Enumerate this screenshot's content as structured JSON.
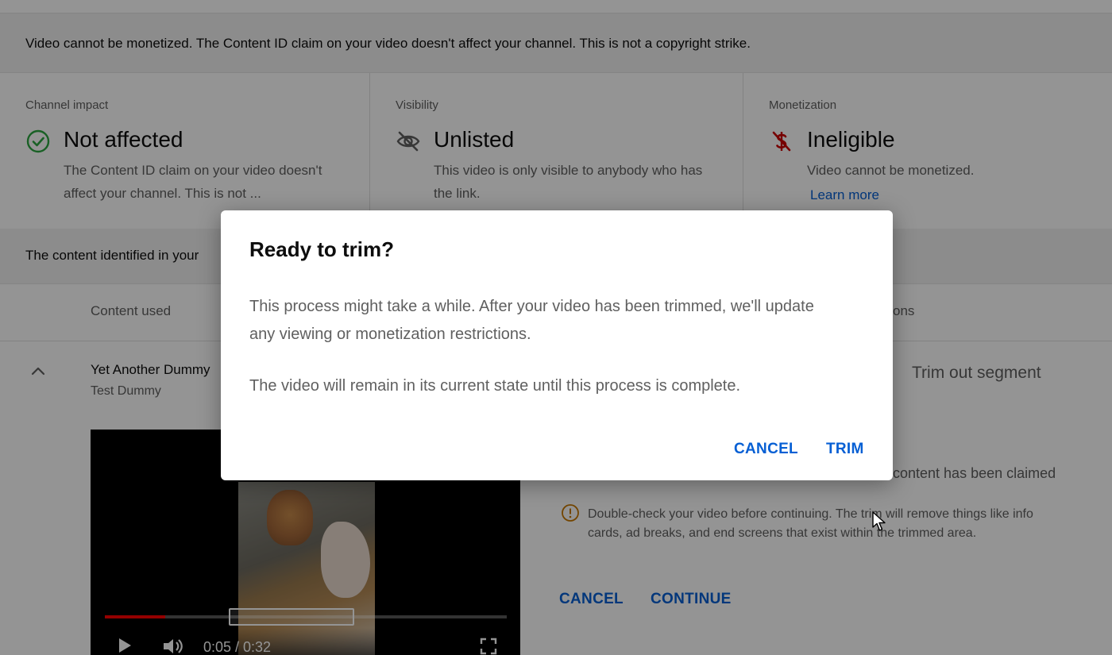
{
  "notice": {
    "text": "Video cannot be monetized. The Content ID claim on your video doesn't affect your channel. This is not a copyright strike."
  },
  "status": [
    {
      "caption": "Channel impact",
      "icon": "check-circle-icon",
      "value": "Not affected",
      "description": "The Content ID claim on your video doesn't affect your channel. This is not ...",
      "color": "#2ba640"
    },
    {
      "caption": "Visibility",
      "icon": "eye-off-icon",
      "value": "Unlisted",
      "description": "This video is only visible to anybody who has the link.",
      "color": "#606060"
    },
    {
      "caption": "Monetization",
      "icon": "dollar-off-icon",
      "value": "Ineligible",
      "description": "Video cannot be monetized.",
      "link": "Learn more",
      "color": "#cc0000"
    }
  ],
  "identified": {
    "text": "The content identified in your"
  },
  "table": {
    "header_content": "Content used",
    "header_actions": "ons"
  },
  "item": {
    "title": "Yet Another Dummy",
    "subtitle": "Test Dummy",
    "action": "Trim out segment",
    "video_time": "0:05 / 0:32",
    "progress": 0.15
  },
  "trim_panel": {
    "claimed_text": "content has been claimed",
    "warning": "Double-check your video before continuing. The trim will remove things like info cards, ad breaks, and end screens that exist within the trimmed area.",
    "cancel_label": "CANCEL",
    "continue_label": "CONTINUE"
  },
  "dialog": {
    "title": "Ready to trim?",
    "paragraph1": "This process might take a while. After your video has been trimmed, we'll update any viewing or monetization restrictions.",
    "paragraph2": "The video will remain in its current state until this process is complete.",
    "cancel_label": "CANCEL",
    "trim_label": "TRIM"
  },
  "colors": {
    "accent": "#065fd4",
    "success": "#2ba640",
    "error": "#cc0000",
    "scrim": "rgba(0,0,0,0.42)"
  }
}
